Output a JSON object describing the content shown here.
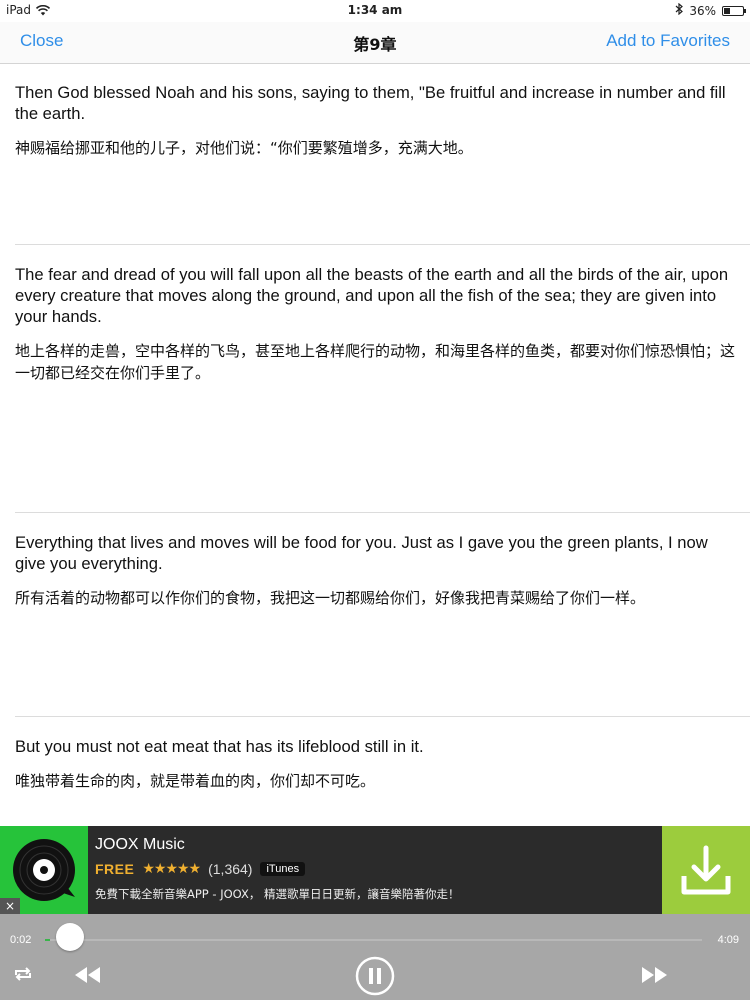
{
  "status_bar": {
    "device": "iPad",
    "time": "1:34 am",
    "battery": "36%",
    "battery_level": 0.36,
    "icons": [
      "wifi-icon",
      "bluetooth-icon",
      "battery-icon"
    ]
  },
  "nav": {
    "close_label": "Close",
    "title": "第9章",
    "favorites_label": "Add to Favorites"
  },
  "verses": [
    {
      "en": "Then God blessed Noah and his sons, saying to them, \"Be fruitful and increase in number and fill the earth.",
      "zh": "神赐福给挪亚和他的儿子，对他们说：“你们要繁殖增多，充满大地。"
    },
    {
      "en": "The fear and dread of you will fall upon all the beasts of the earth and all the birds of the air, upon every creature that moves along the ground, and upon all the fish of the sea; they are given into your hands.",
      "zh": "地上各样的走兽，空中各样的飞鸟，甚至地上各样爬行的动物，和海里各样的鱼类，都要对你们惊恐惧怕；这一切都已经交在你们手里了。"
    },
    {
      "en": "Everything that lives and moves will be food for you. Just as I gave you the green plants, I now give you everything.",
      "zh": "所有活着的动物都可以作你们的食物，我把这一切都赐给你们，好像我把青菜赐给了你们一样。"
    },
    {
      "en": "But you must not eat meat that has its lifeblood still in it.",
      "zh": "唯独带着生命的肉，就是带着血的肉，你们却不可吃。"
    }
  ],
  "ad": {
    "app_name": "JOOX Music",
    "price": "FREE",
    "stars": "★★★★★",
    "rating": 4.5,
    "rating_count": "(1,364)",
    "store_badge": "iTunes",
    "description": "免費下載全新音樂APP - JOOX， 精選歌單日日更新，讓音樂陪著你走！",
    "close_label": "×",
    "colors": {
      "logo_bg": "#26c33a",
      "download_bg": "#9ccc3d",
      "banner_bg": "#2b2b2b"
    }
  },
  "player": {
    "current_time": "0:02",
    "total_time": "4:09",
    "progress": 0.008,
    "icons": [
      "repeat-icon",
      "rewind-icon",
      "pause-icon",
      "fast-forward-icon"
    ],
    "accent": "#39b54a"
  }
}
